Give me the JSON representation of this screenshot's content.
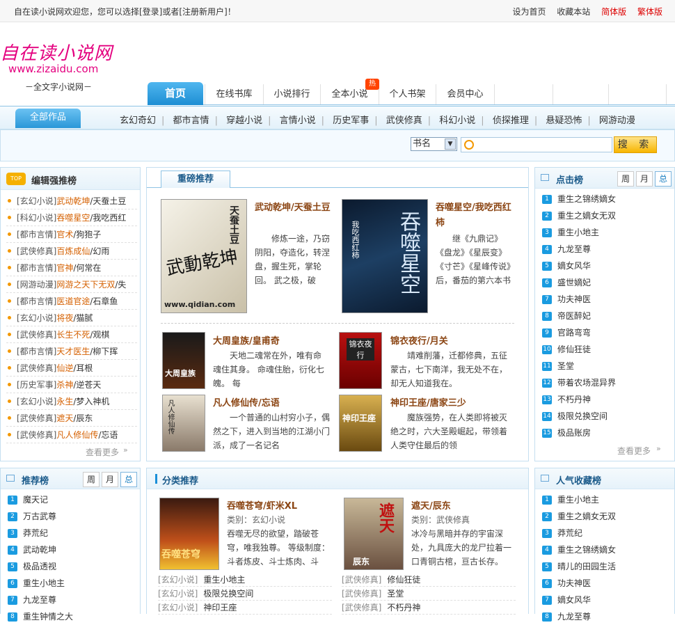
{
  "topbar": {
    "welcome": "自在读小说网欢迎您，您可以选择[登录]或者[注册新用户]！",
    "links": [
      "设为首页",
      "收藏本站",
      "简体版",
      "繁体版"
    ]
  },
  "logo": {
    "name": "自在读小说网",
    "url": "www.zizaidu.com",
    "slogan": "－全文字小说网－"
  },
  "nav": {
    "home": "首页",
    "tabs": [
      "在线书库",
      "小说排行",
      "全本小说",
      "个人书架",
      "会员中心"
    ],
    "hot_badge": "热"
  },
  "subnav": {
    "all": "全部作品",
    "cats": [
      "玄幻奇幻",
      "都市言情",
      "穿越小说",
      "言情小说",
      "历史军事",
      "武侠修真",
      "科幻小说",
      "侦探推理",
      "悬疑恐怖",
      "网游动漫"
    ]
  },
  "search": {
    "select": "书名",
    "button": "搜 索"
  },
  "editor_picks": {
    "title": "编辑强推榜",
    "items": [
      {
        "cat": "[玄幻小说]",
        "book": "武动乾坤",
        "author": "/天蚕土豆"
      },
      {
        "cat": "[科幻小说]",
        "book": "吞噬星空",
        "author": "/我吃西红"
      },
      {
        "cat": "[都市言情]",
        "book": "官术",
        "author": "/狗狍子"
      },
      {
        "cat": "[武侠修真]",
        "book": "百炼成仙",
        "author": "/幻雨"
      },
      {
        "cat": "[都市言情]",
        "book": "官神",
        "author": "/何常在"
      },
      {
        "cat": "[网游动漫]",
        "book": "网游之天下无双",
        "author": "/失"
      },
      {
        "cat": "[都市言情]",
        "book": "医道官途",
        "author": "/石章鱼"
      },
      {
        "cat": "[玄幻小说]",
        "book": "将夜",
        "author": "/猫腻"
      },
      {
        "cat": "[武侠修真]",
        "book": "长生不死",
        "author": "/观棋"
      },
      {
        "cat": "[都市言情]",
        "book": "天才医生",
        "author": "/柳下挥"
      },
      {
        "cat": "[武侠修真]",
        "book": "仙逆",
        "author": "/耳根"
      },
      {
        "cat": "[历史军事]",
        "book": "杀神",
        "author": "/逆苍天"
      },
      {
        "cat": "[玄幻小说]",
        "book": "永生",
        "author": "/梦入神机"
      },
      {
        "cat": "[武侠修真]",
        "book": "遮天",
        "author": "/辰东"
      },
      {
        "cat": "[武侠修真]",
        "book": "凡人修仙传",
        "author": "/忘语"
      }
    ],
    "more": "查看更多"
  },
  "featured": {
    "title": "重磅推荐",
    "big": [
      {
        "title": "武动乾坤/天蚕土豆",
        "desc": "修炼一途，乃窃阴阳，夺造化，转涅盘，握生死，掌轮回。 武之极，破",
        "cover_text": "武動乾坤",
        "cover_sub": "天蚕土豆",
        "cover_site": "www.qidian.com"
      },
      {
        "title": "吞噬星空/我吃西红柿",
        "desc": "继《九鼎记》《盘龙》《星辰变》《寸芒》《星峰传说》后，番茄的第六本书",
        "cover_text": "吞噬星空",
        "cover_sub": "我吃西红柿",
        "cover_site": "www.qidian.com"
      }
    ],
    "small": [
      {
        "title": "大周皇族/皇甫奇",
        "desc": "天地二魂常在外，唯有命魂住其身。 命魂住胎，衍化七魄。 每",
        "cover_text": "大周皇族"
      },
      {
        "title": "锦衣夜行/月关",
        "desc": "靖难削藩，迁都修典，五征蒙古，七下南洋，我无处不在，却无人知道我在。",
        "cover_text": "锦衣夜行"
      },
      {
        "title": "凡人修仙传/忘语",
        "desc": "一个普通的山村穷小子，偶然之下，进入到当地的江湖小门派，成了一名记名",
        "cover_text": "凡人修仙传"
      },
      {
        "title": "神印王座/唐家三少",
        "desc": "魔族强势，在人类即将被灭绝之时，六大圣殿崛起，带领着人类守住最后的领",
        "cover_text": "神印王座"
      }
    ]
  },
  "click_rank": {
    "title": "点击榜",
    "tabs": [
      "周",
      "月",
      "总"
    ],
    "items": [
      "重生之锦绣嫡女",
      "重生之嫡女无双",
      "重生小地主",
      "九龙至尊",
      "嫡女风华",
      "盛世嫡妃",
      "功夫神医",
      "帝医醉妃",
      "官路弯弯",
      "修仙狂徒",
      "圣堂",
      "带着农场混异界",
      "不朽丹神",
      "极限兑换空间",
      "极品账房"
    ],
    "more": "查看更多"
  },
  "recommend_rank": {
    "title": "推荐榜",
    "tabs": [
      "周",
      "月",
      "总"
    ],
    "items": [
      "魔天记",
      "万古武尊",
      "莽荒纪",
      "武动乾坤",
      "极品透视",
      "重生小地主",
      "九龙至尊",
      "重生钟情之大"
    ]
  },
  "category_recs": {
    "title": "分类推荐",
    "cards": [
      {
        "title": "吞噬苍穹/虾米XL",
        "meta": "类别：玄幻小说",
        "desc": "吞噬无尽的欲望，踏破苍穹，唯我独尊。 等级制度：斗者炼皮、斗士炼肉、斗",
        "cover_text": "吞噬苍穹"
      },
      {
        "title": "遮天/辰东",
        "meta": "类别：武侠修真",
        "desc": "冰冷与黑暗并存的宇宙深处，九具庞大的龙尸拉着一口青铜古棺，亘古长存。",
        "cover_text": "遮天",
        "cover_sub": "辰东"
      }
    ],
    "left_list": [
      {
        "cat": "[玄幻小说]",
        "book": "重生小地主"
      },
      {
        "cat": "[玄幻小说]",
        "book": "极限兑换空间"
      },
      {
        "cat": "[玄幻小说]",
        "book": "神印王座"
      }
    ],
    "right_list": [
      {
        "cat": "[武侠修真]",
        "book": "修仙狂徒"
      },
      {
        "cat": "[武侠修真]",
        "book": "圣堂"
      },
      {
        "cat": "[武侠修真]",
        "book": "不朽丹神"
      }
    ]
  },
  "popular_fav": {
    "title": "人气收藏榜",
    "items": [
      "重生小地主",
      "重生之嫡女无双",
      "莽荒纪",
      "重生之锦绣嫡女",
      "晴儿的田园生活",
      "功夫神医",
      "嫡女风华",
      "九龙至尊"
    ]
  }
}
